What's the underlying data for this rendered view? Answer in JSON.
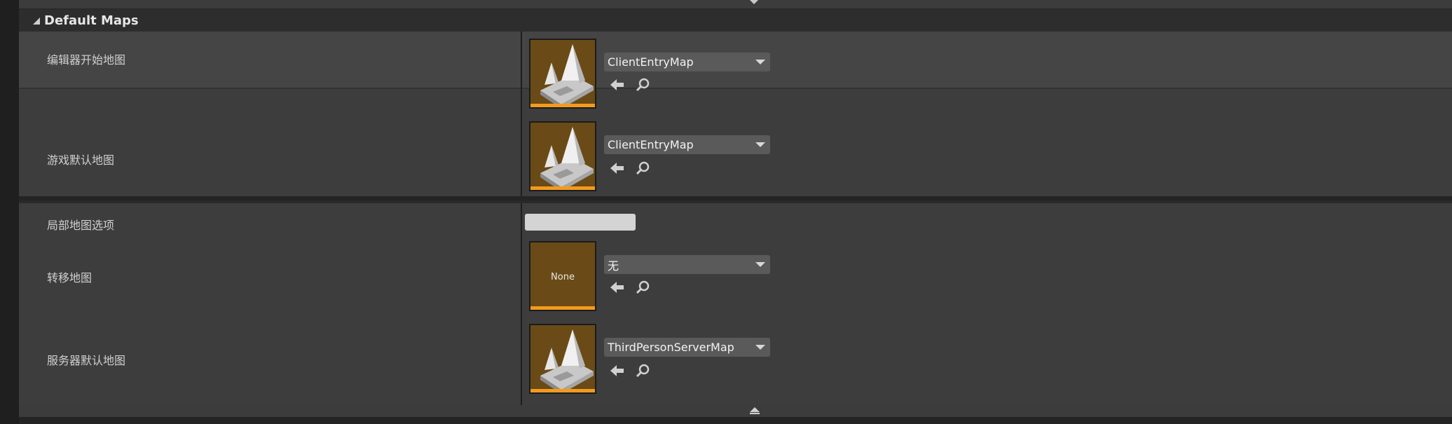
{
  "category": {
    "title": "Default Maps"
  },
  "rows": [
    {
      "label": "编辑器开始地图",
      "map": "ClientEntryMap"
    },
    {
      "label": "游戏默认地图",
      "map": "ClientEntryMap"
    },
    {
      "label": "局部地图选项",
      "value": ""
    },
    {
      "label": "转移地图",
      "map": "无",
      "thumb_text": "None"
    },
    {
      "label": "服务器默认地图",
      "map": "ThirdPersonServerMap"
    }
  ],
  "icons": {
    "browse": "arrow-left-icon",
    "search": "search-icon",
    "expand": "collapse-up-icon",
    "map_thumbnail": "level-map-icon"
  },
  "colors": {
    "thumb_bg": "#6a4a16",
    "accent_bar": "#f39b1d",
    "row_bg_a": "#454545",
    "row_bg_b": "#3d3d3d"
  }
}
